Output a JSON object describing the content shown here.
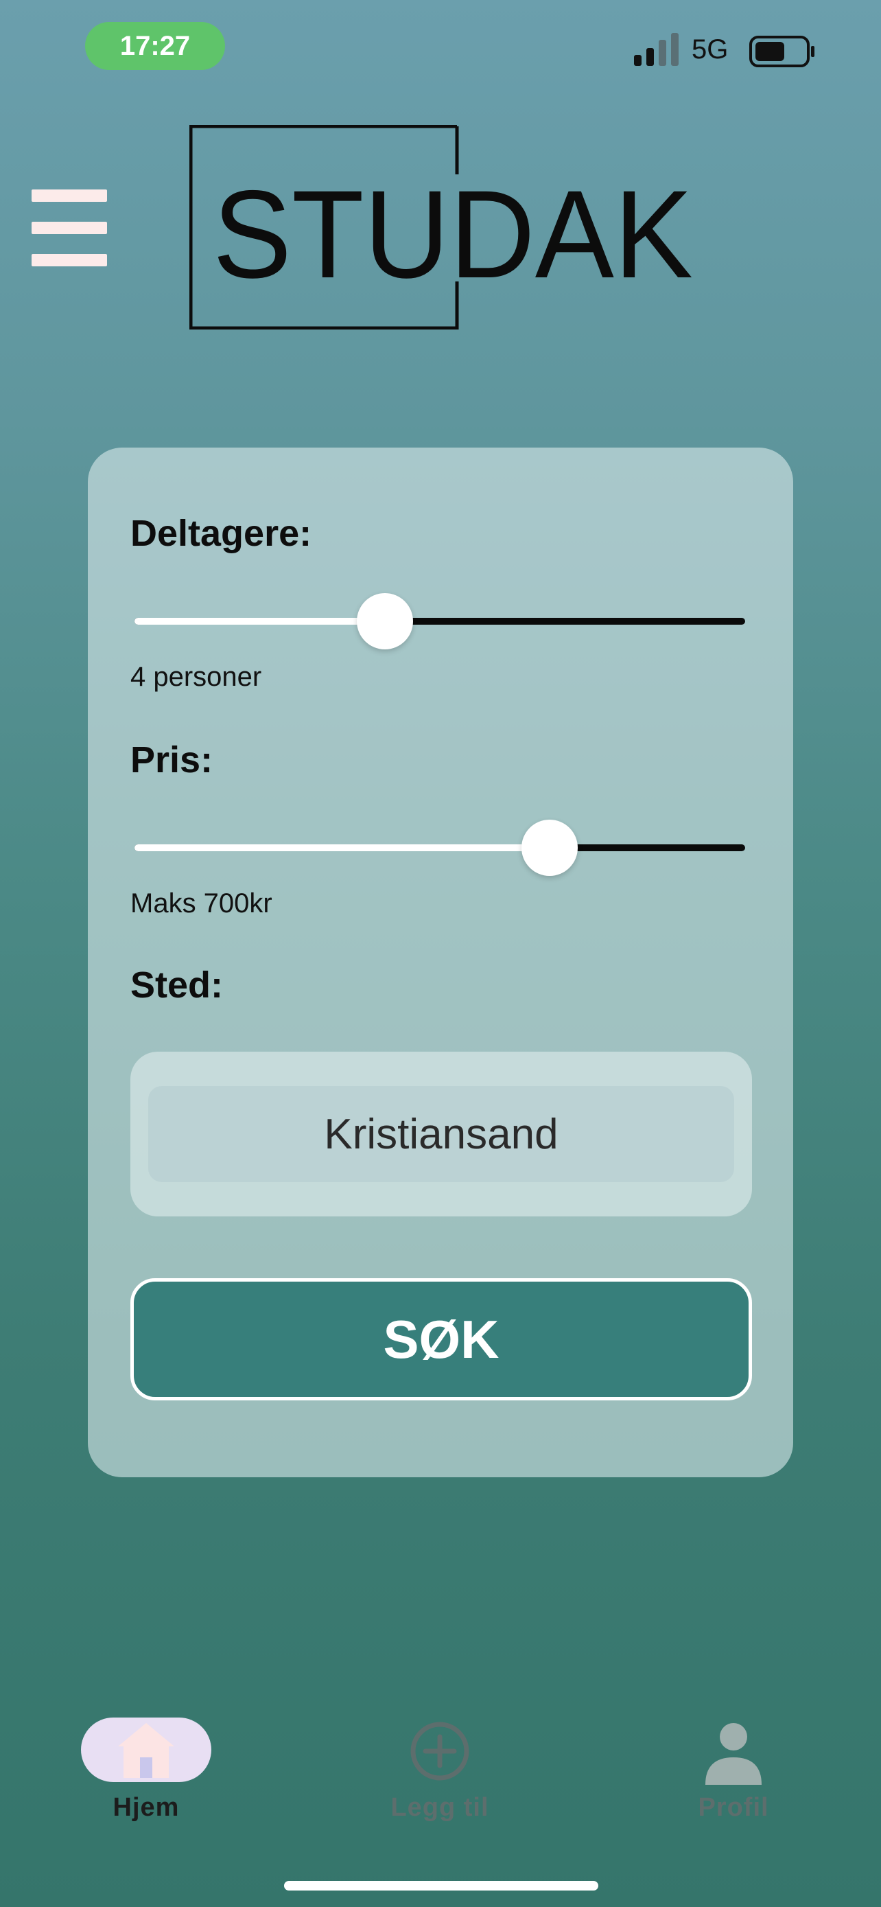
{
  "status_bar": {
    "time": "17:27",
    "network": "5G",
    "signal_bars_active": 2,
    "battery_level": 0.6,
    "time_pill_color": "#5fc46a"
  },
  "header": {
    "menu_icon": "hamburger-menu-icon",
    "logo_text": "STUDAK"
  },
  "search_card": {
    "participants": {
      "label": "Deltagere:",
      "value_text": "4 personer",
      "slider_fraction": 0.41
    },
    "price": {
      "label": "Pris:",
      "value_text": "Maks 700kr",
      "slider_fraction": 0.68
    },
    "location": {
      "label": "Sted:",
      "value": "Kristiansand"
    },
    "search_button_label": "SØK"
  },
  "tab_bar": {
    "tabs": [
      {
        "label": "Hjem",
        "icon": "home-icon",
        "active": true
      },
      {
        "label": "Legg til",
        "icon": "plus-circle-icon",
        "active": false
      },
      {
        "label": "Profil",
        "icon": "person-icon",
        "active": false
      }
    ]
  },
  "colors": {
    "accent": "#377f7b",
    "active_tab_pill": "#e8dff3",
    "inactive_tab": "#5d6e6d"
  }
}
